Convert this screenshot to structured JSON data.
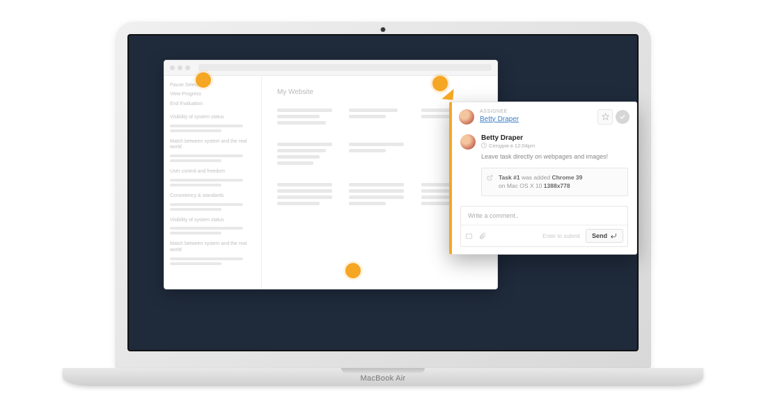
{
  "laptop": {
    "brand": "MacBook Air"
  },
  "browser": {
    "sidebar": {
      "topLinks": [
        "Pause Selection",
        "View Progress",
        "End Evaluation"
      ],
      "heuristics": [
        "Visibility of system status",
        "Match between system and the real world",
        "User control and freedom",
        "Consistency & standards",
        "Visibility of system status",
        "Match between system and the real world"
      ]
    },
    "content": {
      "title": "My Website"
    }
  },
  "panel": {
    "assignee": {
      "label": "ASSIGNEE",
      "name": "Betty Draper"
    },
    "comment": {
      "author": "Betty Draper",
      "timestamp": "Сегодня в 12:04pm",
      "message": "Leave task directly on webpages and images!"
    },
    "meta": {
      "taskLabel": "Task #1",
      "addedText": "was added",
      "browser": "Chrome 39",
      "osPrefix": "on",
      "os": "Mac OS X 10",
      "resolution": "1388x778"
    },
    "input": {
      "placeholder": "Write a comment..",
      "hint": "Enter to submit",
      "sendLabel": "Send"
    }
  },
  "colors": {
    "accent": "#f5a623",
    "link": "#3b7cc4"
  }
}
